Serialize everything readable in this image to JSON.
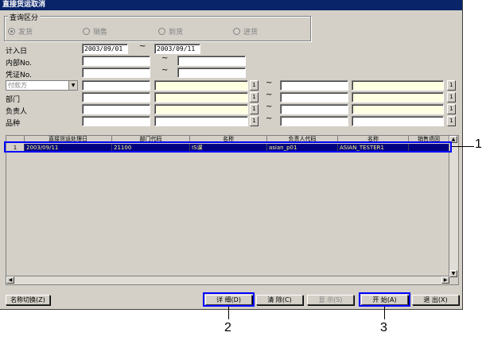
{
  "window": {
    "title": "直接货运取消"
  },
  "query_group": {
    "title": "查询区分",
    "options": [
      {
        "label": "发货",
        "selected": true
      },
      {
        "label": "销售",
        "selected": false
      },
      {
        "label": "到货",
        "selected": false
      },
      {
        "label": "进货",
        "selected": false
      }
    ]
  },
  "form": {
    "entry_date_label": "计入日",
    "entry_date_from": "2003/09/01",
    "entry_date_to": "2003/09/11",
    "tilde": "~",
    "internal_no_label": "内部No.",
    "voucher_no_label": "凭证No.",
    "payer_combo": "付款方",
    "dept_label": "部门",
    "person_label": "负责人",
    "item_label": "品种",
    "search_btn": "1"
  },
  "grid": {
    "columns": [
      "",
      "直接货运处理日",
      "部门代码",
      "名称",
      "负责人代码",
      "名称",
      "销售退回"
    ],
    "rows": [
      [
        "1",
        "2003/09/11",
        "21100",
        "IS课",
        "asian_p01",
        "ASIAN_TESTER1",
        ""
      ]
    ]
  },
  "buttons": {
    "name_switch": "名称切换(Z)",
    "detail": "详 细(D)",
    "clear": "清 除(C)",
    "display": "显 示(S)",
    "start": "开 始(A)",
    "exit": "退 出(X)"
  },
  "callouts": [
    "1",
    "2",
    "3"
  ]
}
